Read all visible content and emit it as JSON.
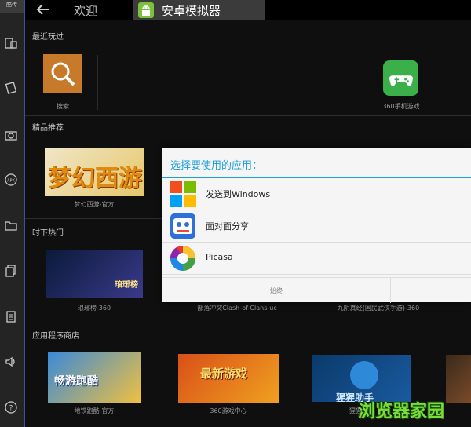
{
  "sidebar": {
    "top_label": "酷传"
  },
  "topbar": {
    "back_title": "欢迎",
    "tab_label": "安卓模拟器"
  },
  "sections": {
    "recent": "最近玩过",
    "featured": "精品推荐",
    "hot": "时下热门",
    "store": "应用程序商店"
  },
  "recent_apps": [
    {
      "label": "搜索"
    },
    {
      "label": "360手机游戏"
    }
  ],
  "featured_apps": [
    {
      "label": "梦幻西游-官方",
      "banner_text": "梦幻西游"
    }
  ],
  "hot_apps": [
    {
      "label": "琅琊榜-360",
      "banner_text": "琅琊榜"
    },
    {
      "label": "部落冲突Clash-of-Clans-uc"
    },
    {
      "label": "九阴真经(国民武侠手游)-360"
    }
  ],
  "store_apps": [
    {
      "label": "地铁跑酷-官方",
      "banner_text": "畅游跑酷"
    },
    {
      "label": "360游戏中心",
      "banner_text": "最新游戏"
    },
    {
      "label": "猩猩助手",
      "banner_text": "猩猩助手"
    }
  ],
  "dialog": {
    "title": "选择要使用的应用：",
    "options": [
      {
        "label": "发送到Windows"
      },
      {
        "label": "面对面分享"
      },
      {
        "label": "Picasa"
      }
    ],
    "always_label": "始终"
  },
  "watermark": "浏览器家园"
}
